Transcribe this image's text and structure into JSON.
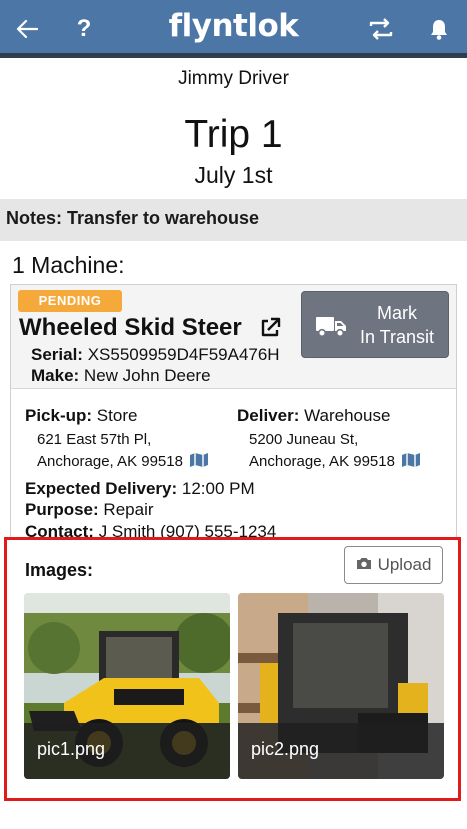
{
  "header": {
    "logo": "flyntlok",
    "icons": [
      "back-arrow-icon",
      "help-icon",
      "swap-icon",
      "bell-icon"
    ],
    "help_label": "?",
    "background_color": "#4b76a6"
  },
  "driver_name": "Jimmy Driver",
  "trip": {
    "title": "Trip 1",
    "date": "July 1st"
  },
  "notes": "Notes: Transfer to warehouse",
  "machine_count": "1 Machine:",
  "machine": {
    "status": "PENDING",
    "status_color": "#f6a93b",
    "name": "Wheeled Skid Steer",
    "serial_label": "Serial:",
    "serial": "XS5509959D4F59A476H",
    "make_label": "Make:",
    "make": "New John Deere",
    "action_button": {
      "line1": "Mark",
      "line2": "In Transit",
      "icon": "truck-icon"
    }
  },
  "pickup": {
    "label": "Pick-up:",
    "name": "Store",
    "address1": "621 East 57th Pl,",
    "address2": "Anchorage, AK 99518"
  },
  "deliver": {
    "label": "Deliver:",
    "name": "Warehouse",
    "address1": "5200 Juneau St,",
    "address2": "Anchorage, AK 99518"
  },
  "expected_delivery": {
    "label": "Expected Delivery:",
    "value": "12:00 PM"
  },
  "purpose": {
    "label": "Purpose:",
    "value": "Repair"
  },
  "contact": {
    "label": "Contact:",
    "value": "J Smith (907) 555-1234"
  },
  "images": {
    "label": "Images:",
    "upload_label": "Upload",
    "items": [
      {
        "caption": "pic1.png"
      },
      {
        "caption": "pic2.png"
      }
    ]
  }
}
